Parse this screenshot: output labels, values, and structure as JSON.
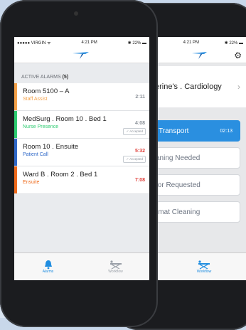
{
  "front": {
    "status": {
      "carrier": "●●●●● VIRGIN",
      "time": "4:21 PM",
      "battery": "22%"
    },
    "section_title": "ACTIVE ALARMS",
    "section_count": "(5)",
    "alarms": [
      {
        "location": "Room 5100 – A",
        "type": "Staff Assist",
        "time": "2:11",
        "color": "#f4a24a",
        "time_color": "#8c929a",
        "accepted": ""
      },
      {
        "location": "MedSurg . Room 10 . Bed 1",
        "type": "Nurse Presence",
        "time": "4:08",
        "color": "#2ecc71",
        "time_color": "#8c929a",
        "accepted": "✓ Accepted"
      },
      {
        "location": "Room 10 . Ensuite",
        "type": "Patient Call",
        "time": "5:32",
        "color": "#2f68c8",
        "time_color": "#e0403b",
        "accepted": "✓ Accepted"
      },
      {
        "location": "Ward B . Room 2 . Bed 1",
        "type": "Ensuite",
        "time": "7:08",
        "color": "#ef6b1d",
        "time_color": "#e0403b",
        "accepted": ""
      }
    ],
    "tabs": [
      {
        "label": "Alarms",
        "active": true
      },
      {
        "label": "Workflow",
        "active": false
      }
    ]
  },
  "back": {
    "status": {
      "time": "4:21 PM",
      "battery": "22%"
    },
    "patient": "erine's . Cardiology",
    "workflow": [
      {
        "label": "Transport",
        "time": "02:13",
        "active": true
      },
      {
        "label": "aning Needed",
        "time": "",
        "active": false
      },
      {
        "label": "tor Requested",
        "time": "",
        "active": false
      },
      {
        "label": "rmat Cleaning",
        "time": "",
        "active": false
      }
    ],
    "tab_label": "Workflow"
  },
  "colors": {
    "accent": "#2a8fe0",
    "alert": "#e0403b"
  }
}
